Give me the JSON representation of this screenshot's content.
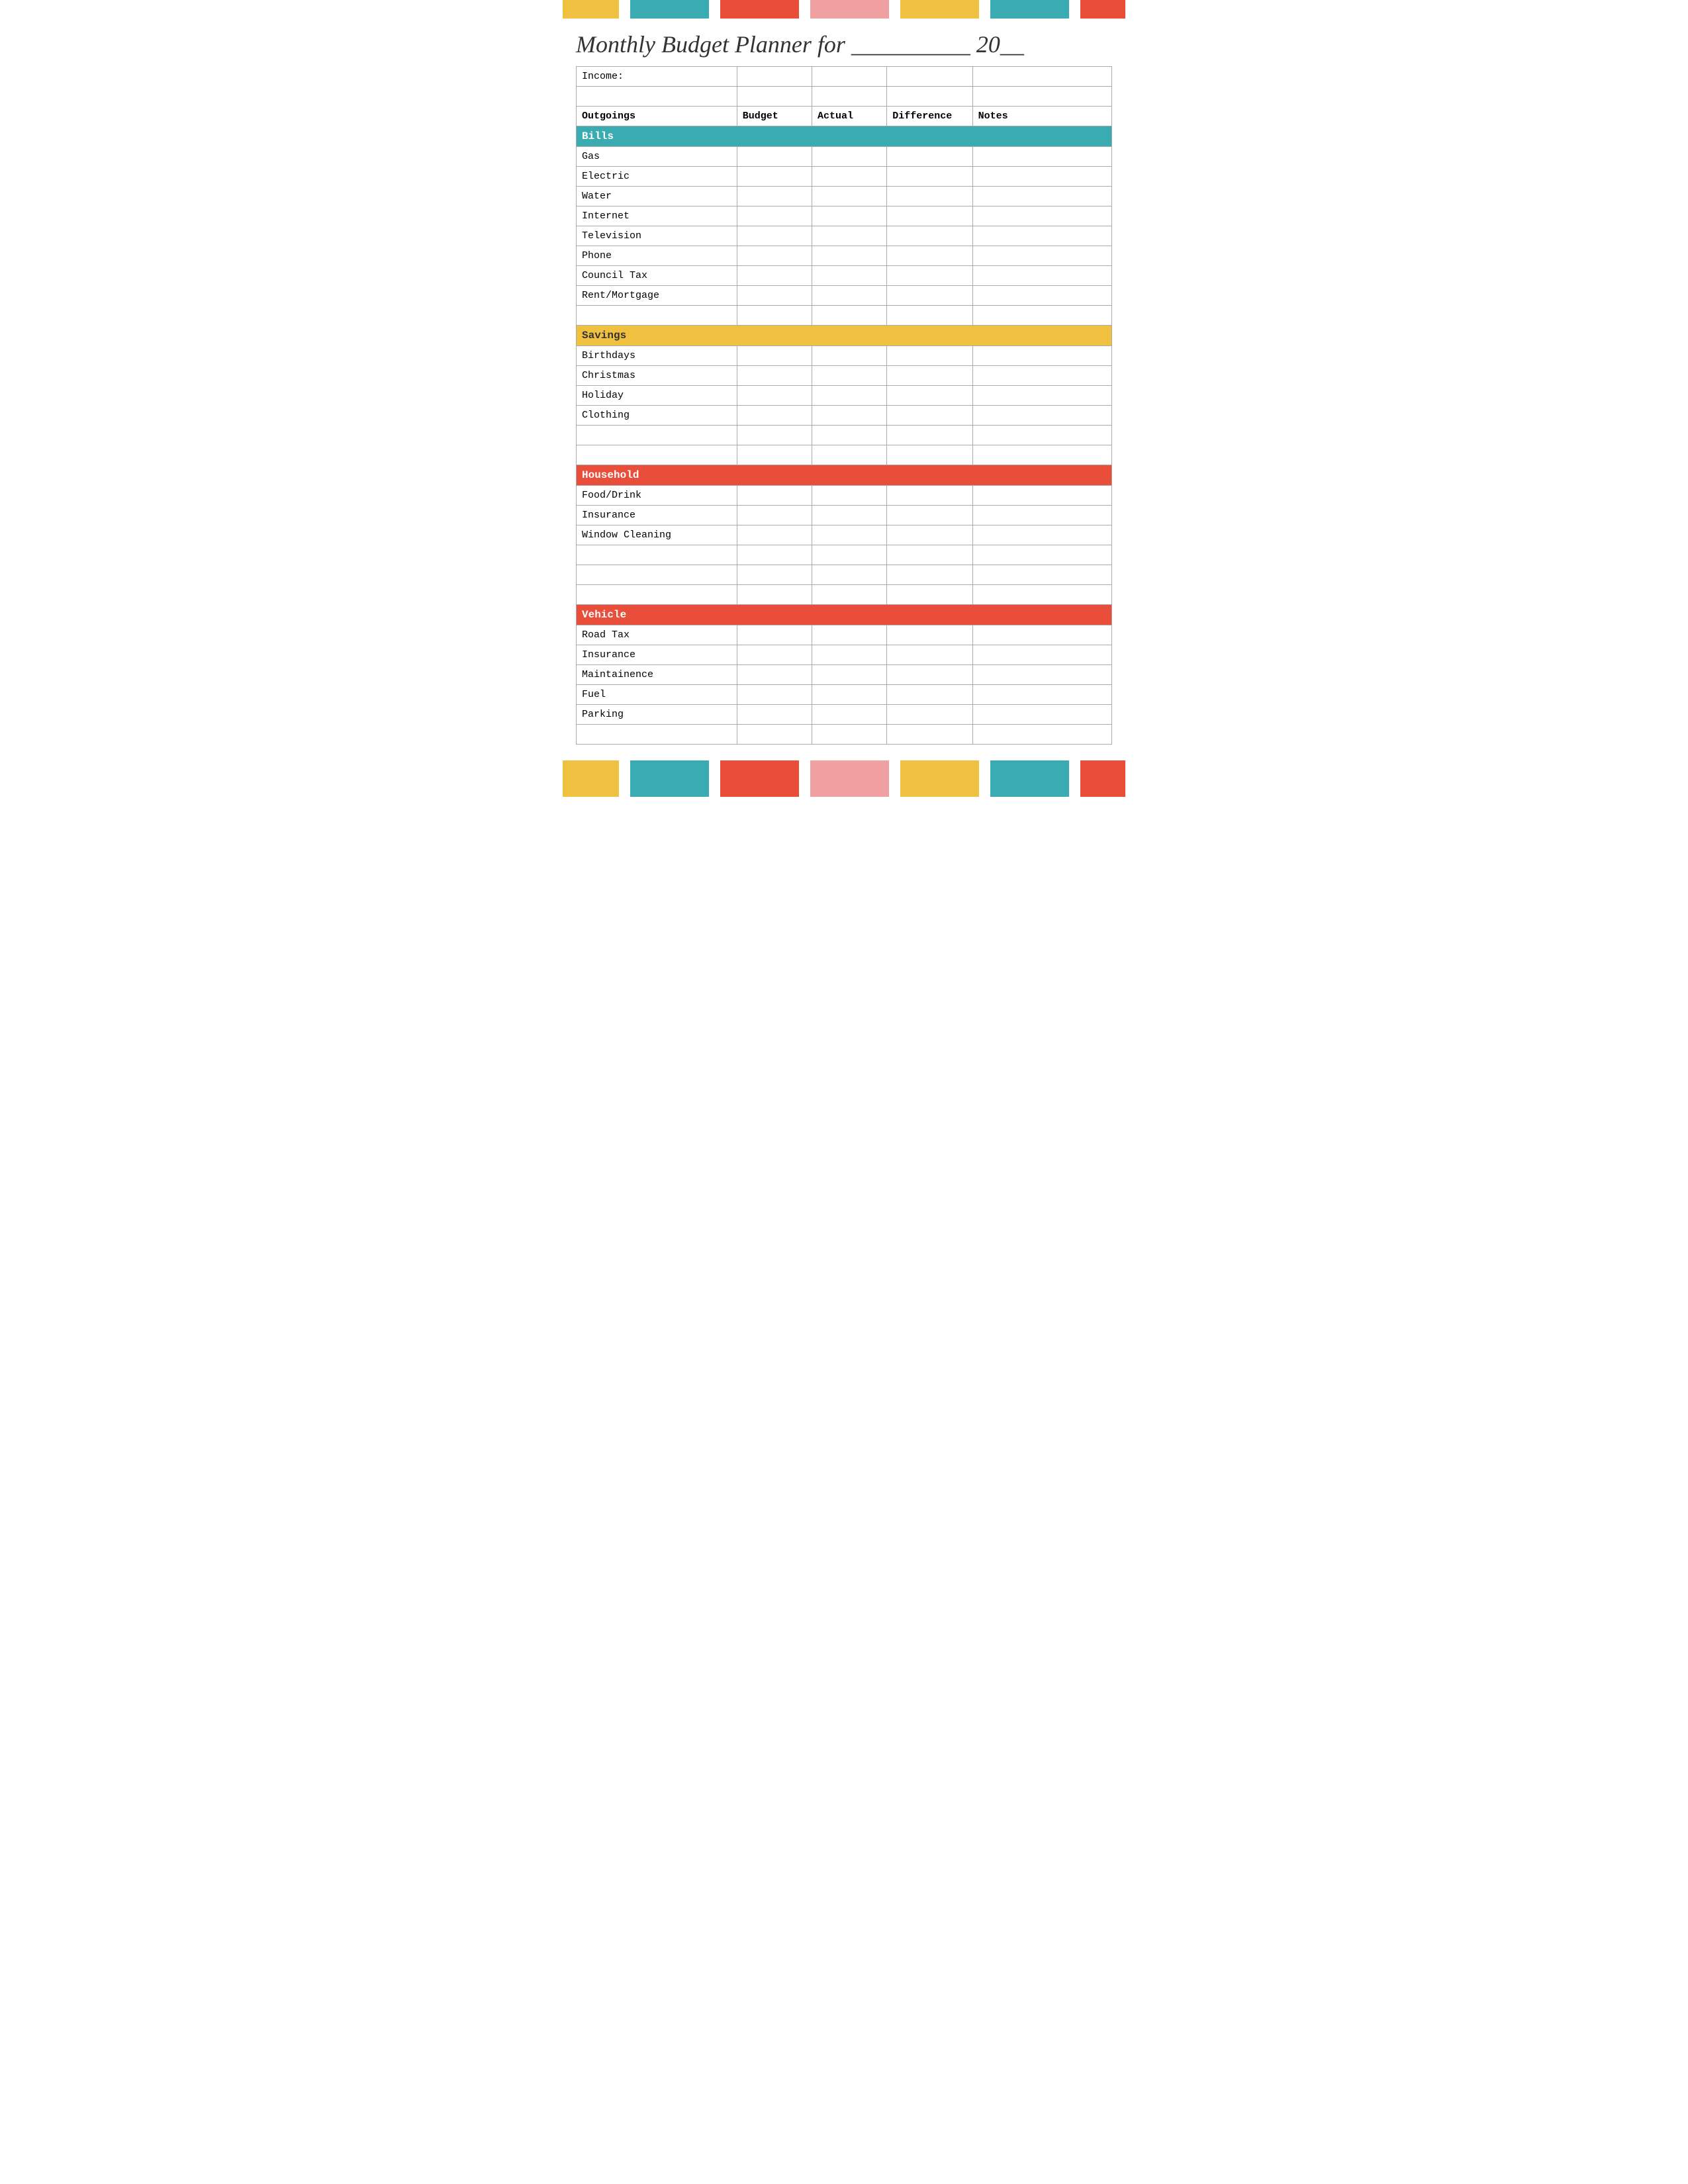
{
  "page": {
    "title": "Monthly Budget Planner for __________ 20__",
    "top_bars": [
      {
        "color": "#f0c040",
        "width": "10%"
      },
      {
        "color": "#ffffff",
        "width": "2%"
      },
      {
        "color": "#3aabb0",
        "width": "14%"
      },
      {
        "color": "#ffffff",
        "width": "2%"
      },
      {
        "color": "#e84e3a",
        "width": "14%"
      },
      {
        "color": "#ffffff",
        "width": "2%"
      },
      {
        "color": "#f0a0a0",
        "width": "14%"
      },
      {
        "color": "#ffffff",
        "width": "2%"
      },
      {
        "color": "#f0c040",
        "width": "14%"
      },
      {
        "color": "#ffffff",
        "width": "2%"
      },
      {
        "color": "#3aabb0",
        "width": "14%"
      },
      {
        "color": "#ffffff",
        "width": "2%"
      },
      {
        "color": "#e84e3a",
        "width": "8%"
      }
    ],
    "bottom_bars": [
      {
        "color": "#f0c040",
        "width": "10%"
      },
      {
        "color": "#ffffff",
        "width": "2%"
      },
      {
        "color": "#3aabb0",
        "width": "14%"
      },
      {
        "color": "#ffffff",
        "width": "2%"
      },
      {
        "color": "#e84e3a",
        "width": "14%"
      },
      {
        "color": "#ffffff",
        "width": "2%"
      },
      {
        "color": "#f0a0a0",
        "width": "14%"
      },
      {
        "color": "#ffffff",
        "width": "2%"
      },
      {
        "color": "#f0c040",
        "width": "14%"
      },
      {
        "color": "#ffffff",
        "width": "2%"
      },
      {
        "color": "#3aabb0",
        "width": "14%"
      },
      {
        "color": "#ffffff",
        "width": "2%"
      },
      {
        "color": "#e84e3a",
        "width": "8%"
      }
    ]
  },
  "table": {
    "income_label": "Income:",
    "headers": {
      "outgoings": "Outgoings",
      "budget": "Budget",
      "actual": "Actual",
      "difference": "Difference",
      "notes": "Notes"
    },
    "sections": {
      "bills": {
        "label": "Bills",
        "items": [
          "Gas",
          "Electric",
          "Water",
          "Internet",
          "Television",
          "Phone",
          "Council Tax",
          "Rent/Mortgage"
        ]
      },
      "savings": {
        "label": "Savings",
        "items": [
          "Birthdays",
          "Christmas",
          "Holiday",
          "Clothing"
        ]
      },
      "household": {
        "label": "Household",
        "items": [
          "Food/Drink",
          "Insurance",
          "Window Cleaning"
        ]
      },
      "vehicle": {
        "label": "Vehicle",
        "items": [
          "Road Tax",
          "Insurance",
          "Maintainence",
          "Fuel",
          "Parking"
        ]
      }
    }
  }
}
